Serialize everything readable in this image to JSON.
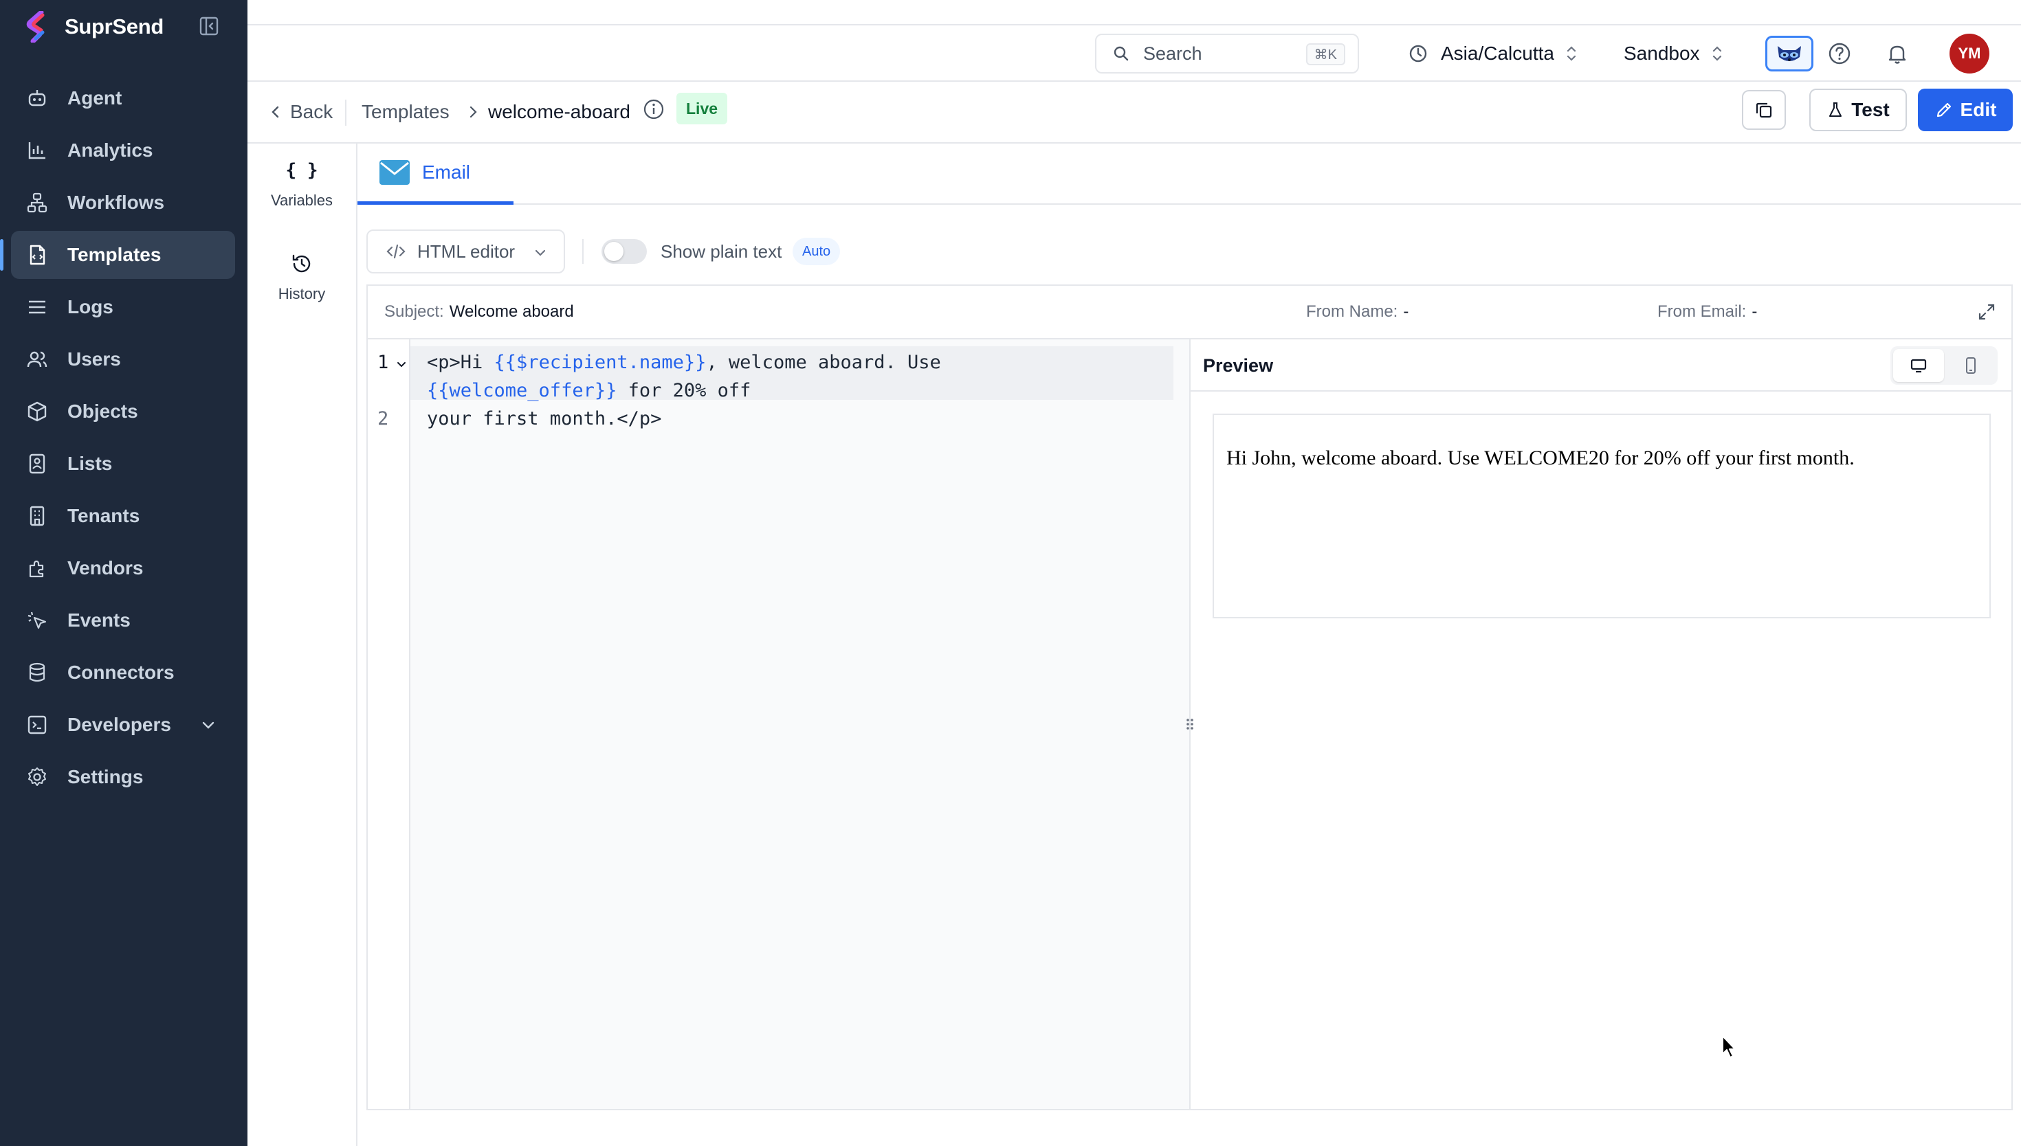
{
  "app": {
    "name": "SuprSend"
  },
  "colors": {
    "sidebar_bg": "#1e293b",
    "accent": "#2563eb",
    "live_badge_bg": "#dcfce7",
    "live_badge_fg": "#15803d",
    "avatar_bg": "#b91c1c"
  },
  "sidebar": {
    "items": [
      {
        "label": "Agent",
        "icon": "agent-icon"
      },
      {
        "label": "Analytics",
        "icon": "analytics-icon"
      },
      {
        "label": "Workflows",
        "icon": "workflows-icon"
      },
      {
        "label": "Templates",
        "icon": "templates-icon",
        "active": true
      },
      {
        "label": "Logs",
        "icon": "logs-icon"
      },
      {
        "label": "Users",
        "icon": "users-icon"
      },
      {
        "label": "Objects",
        "icon": "objects-icon"
      },
      {
        "label": "Lists",
        "icon": "lists-icon"
      },
      {
        "label": "Tenants",
        "icon": "tenants-icon"
      },
      {
        "label": "Vendors",
        "icon": "vendors-icon"
      },
      {
        "label": "Events",
        "icon": "events-icon"
      },
      {
        "label": "Connectors",
        "icon": "connectors-icon"
      },
      {
        "label": "Developers",
        "icon": "developers-icon",
        "expandable": true
      },
      {
        "label": "Settings",
        "icon": "settings-icon"
      }
    ]
  },
  "topbar": {
    "search_placeholder": "Search",
    "search_shortcut": "⌘K",
    "timezone": "Asia/Calcutta",
    "environment": "Sandbox",
    "avatar_initials": "YM"
  },
  "breadcrumb": {
    "back_label": "Back",
    "parent": "Templates",
    "current": "welcome-aboard",
    "status": "Live"
  },
  "actions": {
    "test_label": "Test",
    "edit_label": "Edit"
  },
  "rail": {
    "variables_glyph": "{ }",
    "variables_label": "Variables",
    "history_label": "History"
  },
  "tabs": [
    {
      "label": "Email",
      "active": true
    }
  ],
  "editor": {
    "mode_label": "HTML editor",
    "plain_text_label": "Show plain text",
    "plain_text_enabled": false,
    "auto_badge": "Auto",
    "subject_key": "Subject:",
    "subject_value": "Welcome aboard",
    "from_name_key": "From Name:",
    "from_name_value": "-",
    "from_email_key": "From Email:",
    "from_email_value": "-",
    "line_numbers": [
      "1",
      "2"
    ],
    "code": {
      "l1_a": "<p>Hi ",
      "l1_var": "{{$recipient.name}}",
      "l1_b": ", welcome aboard. Use",
      "l1w_var": "{{welcome_offer}}",
      "l1w_b": " for 20% off",
      "l2": "your first month.</p>"
    }
  },
  "preview": {
    "title": "Preview",
    "device": "desktop",
    "rendered_text": "Hi John, welcome aboard. Use WELCOME20 for 20% off your first month."
  }
}
